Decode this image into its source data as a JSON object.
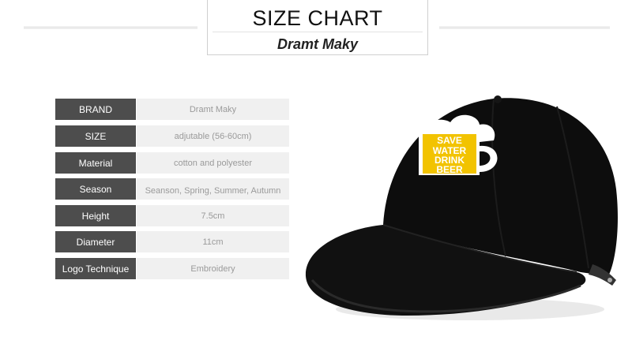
{
  "header": {
    "title": "SIZE CHART",
    "brand": "Dramt Maky"
  },
  "specs": [
    {
      "label": "BRAND",
      "value": "Dramt Maky"
    },
    {
      "label": "SIZE",
      "value": "adjutable (56-60cm)"
    },
    {
      "label": "Material",
      "value": "cotton and polyester"
    },
    {
      "label": "Season",
      "value": "Seanson, Spring, Summer, Autumn"
    },
    {
      "label": "Height",
      "value": "7.5cm"
    },
    {
      "label": "Diameter",
      "value": "11cm"
    },
    {
      "label": "Logo Technique",
      "value": "Embroidery"
    }
  ],
  "product": {
    "logo_text": [
      "SAVE",
      "WATER",
      "DRINK",
      "BEER"
    ],
    "colors": {
      "cap": "#0d0d0d",
      "logo_yellow": "#f2c300",
      "logo_white": "#ffffff"
    }
  }
}
